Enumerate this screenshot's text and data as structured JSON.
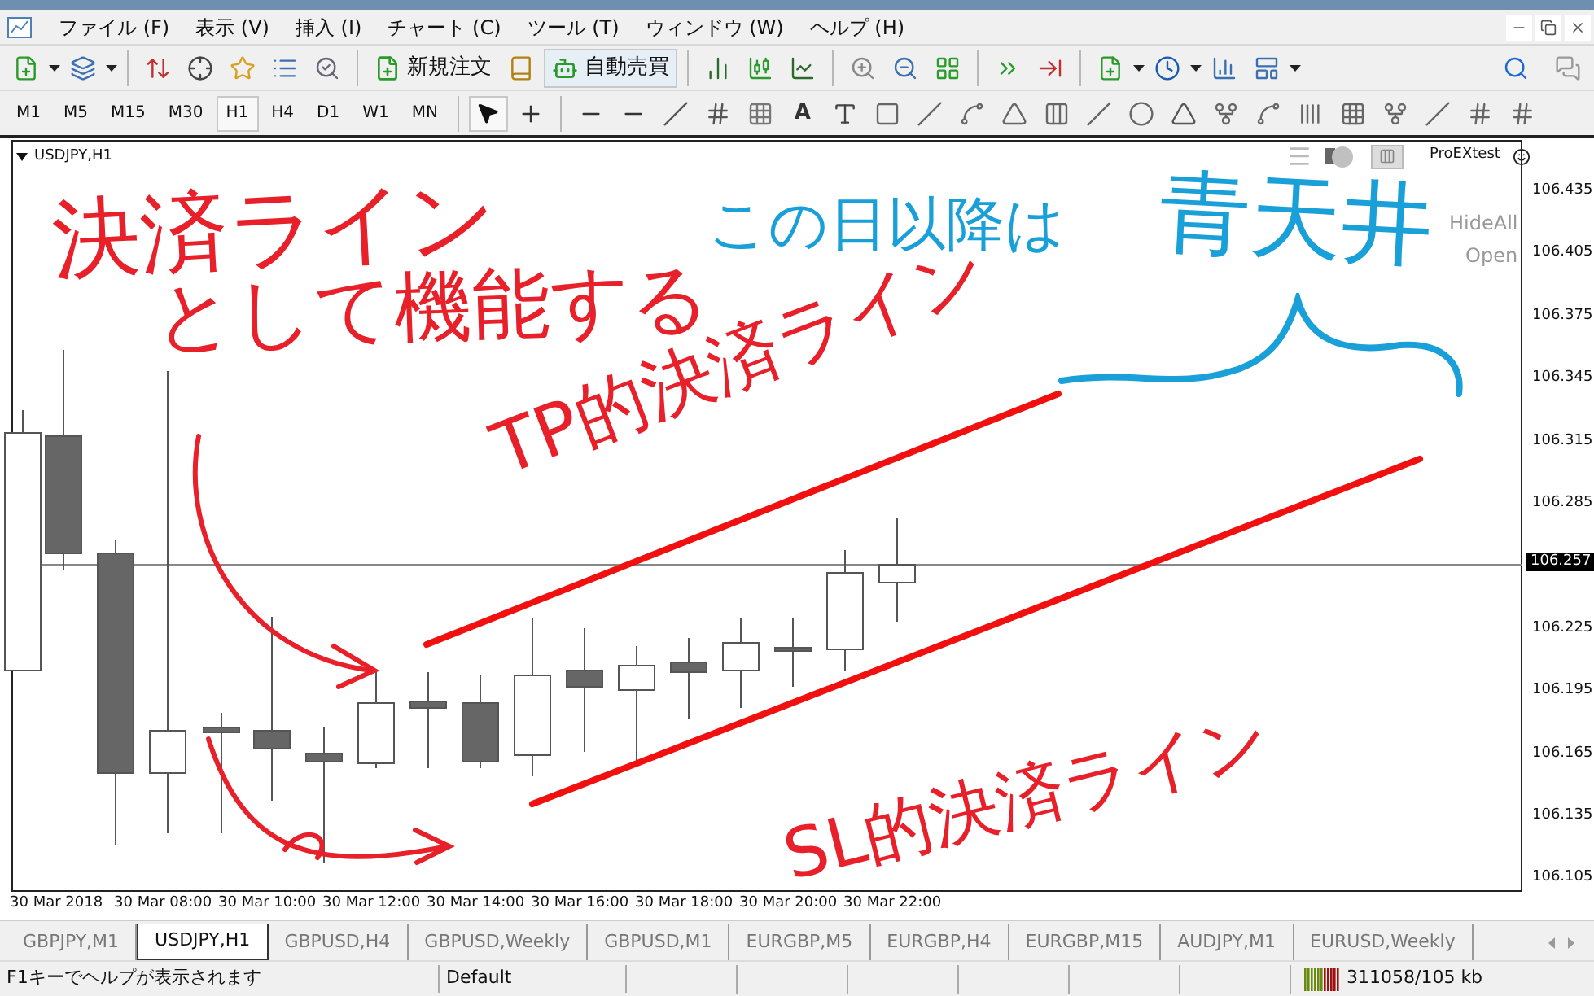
{
  "menu": [
    {
      "label": "ファイル (F)"
    },
    {
      "label": "表示 (V)"
    },
    {
      "label": "挿入 (I)"
    },
    {
      "label": "チャート (C)"
    },
    {
      "label": "ツール (T)"
    },
    {
      "label": "ウィンドウ (W)"
    },
    {
      "label": "ヘルプ (H)"
    }
  ],
  "toolbar": {
    "new_order": "新規注文",
    "auto_trading": {
      "label": "自動売買",
      "on": true
    }
  },
  "timeframes": [
    {
      "label": "M1",
      "selected": false
    },
    {
      "label": "M5",
      "selected": false
    },
    {
      "label": "M15",
      "selected": false
    },
    {
      "label": "M30",
      "selected": false
    },
    {
      "label": "H1",
      "selected": true
    },
    {
      "label": "H4",
      "selected": false
    },
    {
      "label": "D1",
      "selected": false
    },
    {
      "label": "W1",
      "selected": false
    },
    {
      "label": "MN",
      "selected": false
    }
  ],
  "drawing_tools": {
    "text_tool": "A"
  },
  "chart": {
    "symbol": "USDJPY,H1",
    "toggle": {
      "on": true
    },
    "indicator": "ProEXtest",
    "overlay_buttons": [
      "HideAll",
      "Open"
    ],
    "price_labels": [
      "106.435",
      "106.405",
      "106.375",
      "106.345",
      "106.315",
      "106.285",
      "106.225",
      "106.195",
      "106.165",
      "106.135",
      "106.105"
    ],
    "current_price": "106.257",
    "time_labels": [
      "30 Mar 2018",
      "30 Mar 08:00",
      "30 Mar 10:00",
      "30 Mar 12:00",
      "30 Mar 14:00",
      "30 Mar 16:00",
      "30 Mar 18:00",
      "30 Mar 20:00",
      "30 Mar 22:00"
    ]
  },
  "annotations": [
    {
      "text": "決済ライン",
      "color": "#e8202a"
    },
    {
      "text": "として機能する",
      "color": "#e8202a"
    },
    {
      "text": "この日以降は",
      "color": "#1aa0d8"
    },
    {
      "text": "青天井",
      "color": "#1aa0d8"
    },
    {
      "text": "TP的決済ライン",
      "color": "#e8202a"
    },
    {
      "text": "SL的決済ライン",
      "color": "#e8202a"
    }
  ],
  "tabs": [
    {
      "label": "GBPJPY,M1",
      "selected": false
    },
    {
      "label": "USDJPY,H1",
      "selected": true
    },
    {
      "label": "GBPUSD,H4",
      "selected": false
    },
    {
      "label": "GBPUSD,Weekly",
      "selected": false
    },
    {
      "label": "GBPUSD,M1",
      "selected": false
    },
    {
      "label": "EURGBP,M5",
      "selected": false
    },
    {
      "label": "EURGBP,H4",
      "selected": false
    },
    {
      "label": "EURGBP,M15",
      "selected": false
    },
    {
      "label": "AUDJPY,M1",
      "selected": false
    },
    {
      "label": "EURUSD,Weekly",
      "selected": false
    }
  ],
  "status_bar": {
    "help": "F1キーでヘルプが表示されます",
    "profile": "Default",
    "traffic": "311058/105 kb"
  }
}
